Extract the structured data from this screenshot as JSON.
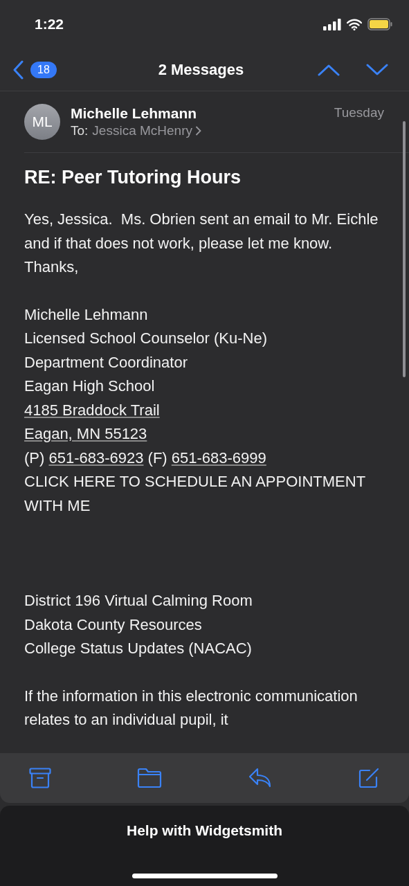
{
  "status_bar": {
    "time": "1:22"
  },
  "nav": {
    "unread_count": "18",
    "title": "2 Messages"
  },
  "message": {
    "avatar_initials": "ML",
    "sender": "Michelle Lehmann",
    "to_label": "To:",
    "recipient": "Jessica McHenry",
    "date": "Tuesday",
    "subject": "RE: Peer Tutoring Hours",
    "blocks": [
      {
        "lines": [
          [
            {
              "text": "Yes, Jessica.  Ms. Obrien sent an email to Mr. Eichle and if that does not work, please let me know.",
              "link": false
            }
          ],
          [
            {
              "text": "Thanks,",
              "link": false
            }
          ]
        ]
      },
      {
        "lines": [
          [
            {
              "text": "Michelle Lehmann",
              "link": false
            }
          ],
          [
            {
              "text": "Licensed School Counselor (Ku-Ne)",
              "link": false
            }
          ],
          [
            {
              "text": "Department Coordinator",
              "link": false
            }
          ],
          [
            {
              "text": "Eagan High School",
              "link": false
            }
          ],
          [
            {
              "text": "4185 Braddock Trail",
              "link": true
            }
          ],
          [
            {
              "text": "Eagan, MN 55123",
              "link": true
            }
          ],
          [
            {
              "text": "(P) ",
              "link": false
            },
            {
              "text": "651-683-6923",
              "link": true
            },
            {
              "text": " (F) ",
              "link": false
            },
            {
              "text": "651-683-6999",
              "link": true
            }
          ],
          [
            {
              "text": "CLICK HERE TO SCHEDULE AN APPOINTMENT WITH ME",
              "link": false
            }
          ]
        ]
      },
      {
        "lines": [
          [
            {
              "text": "District 196 Virtual Calming Room",
              "link": false
            }
          ],
          [
            {
              "text": "Dakota County Resources",
              "link": false
            }
          ],
          [
            {
              "text": "College Status Updates (NACAC)",
              "link": false
            }
          ]
        ]
      },
      {
        "lines": [
          [
            {
              "text": "If the information in this electronic communication relates to an individual pupil, it",
              "link": false
            }
          ]
        ]
      }
    ]
  },
  "sheet": {
    "title": "Help with Widgetsmith"
  }
}
